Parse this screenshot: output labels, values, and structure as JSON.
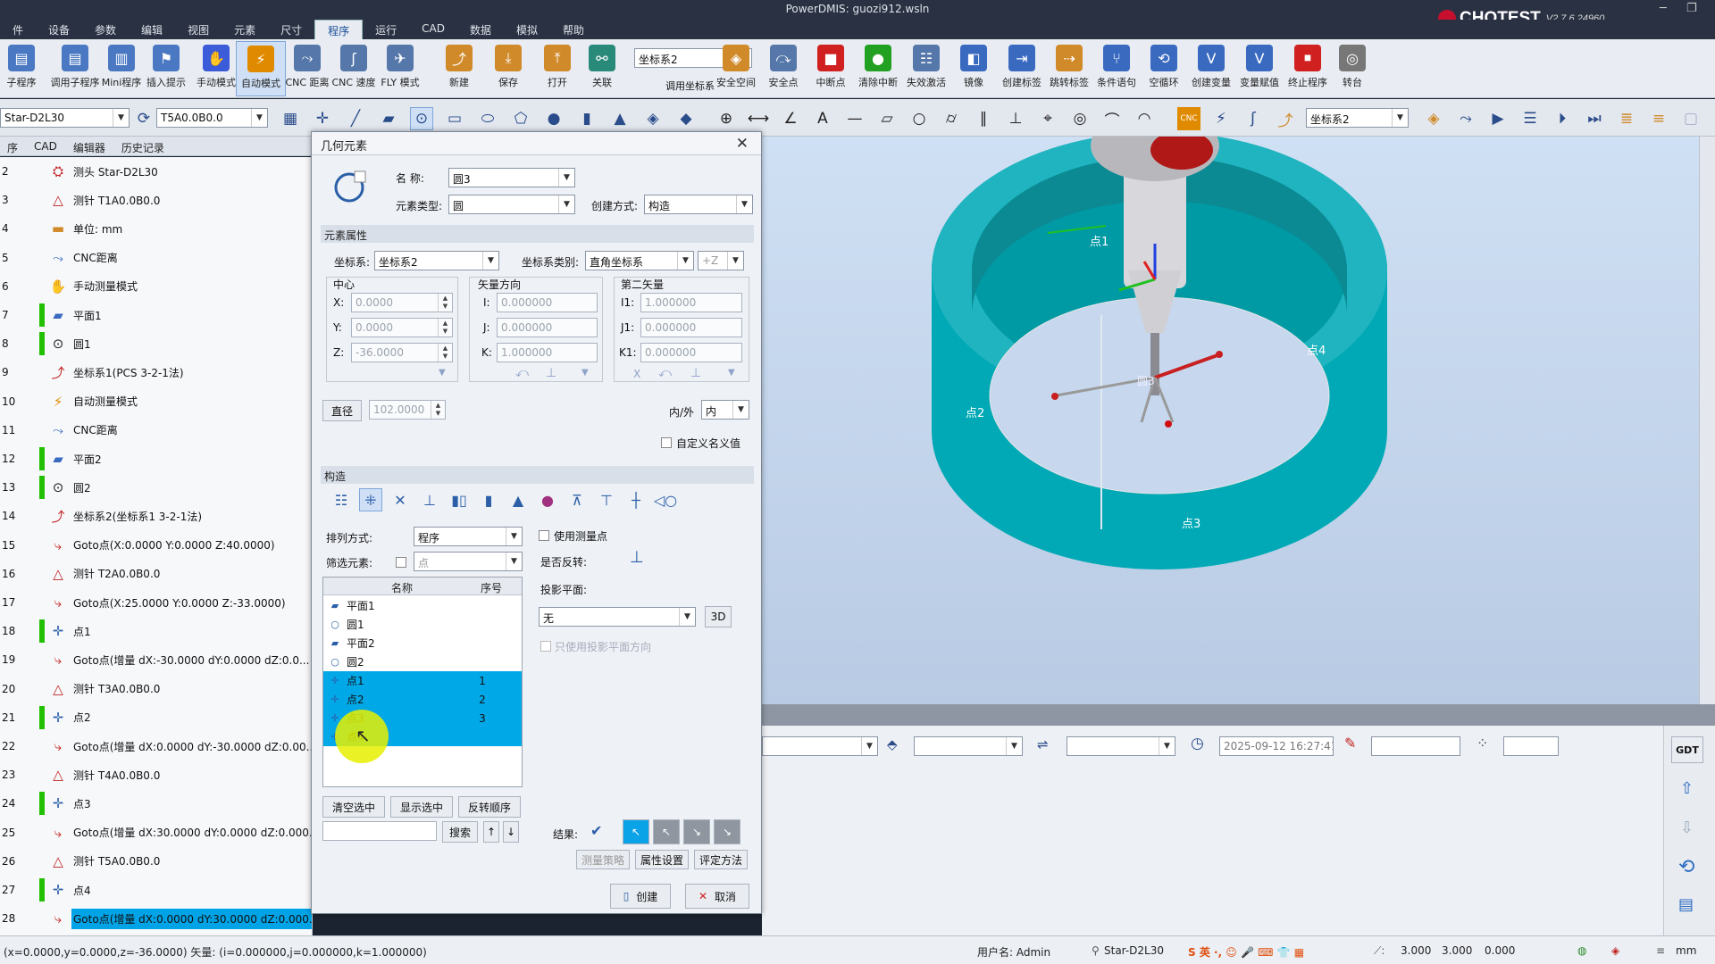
{
  "app": {
    "title": "PowerDMIS: guozi912.wsln",
    "brand": "CHOTEST",
    "version": "V2.7.6.24960"
  },
  "menu": [
    "件",
    "设备",
    "参数",
    "编辑",
    "视图",
    "元素",
    "尺寸",
    "程序",
    "运行",
    "CAD",
    "数据",
    "模拟",
    "帮助"
  ],
  "ribbon": {
    "items": [
      {
        "label": "子程序",
        "icon": "subprogram-icon",
        "color": "#4a78c2"
      },
      {
        "label": "调用子程序",
        "icon": "call-subprogram-icon",
        "color": "#4a78c2"
      },
      {
        "label": "Mini程序",
        "icon": "mini-program-icon",
        "color": "#4a78c2"
      },
      {
        "label": "插入提示",
        "icon": "insert-prompt-icon",
        "color": "#4a78c2"
      },
      {
        "label": "手动模式",
        "icon": "hand-icon",
        "color": "#3c5bd8"
      },
      {
        "label": "自动模式",
        "icon": "cnc-icon",
        "color": "#e08a00"
      },
      {
        "label": "CNC 距离",
        "icon": "cnc-distance-icon",
        "color": "#5577aa"
      },
      {
        "label": "CNC 速度",
        "icon": "cnc-speed-icon",
        "color": "#5577aa"
      },
      {
        "label": "FLY 模式",
        "icon": "fly-mode-icon",
        "color": "#5577aa"
      },
      {
        "label": "新建",
        "icon": "new-coordinate-icon",
        "color": "#d08a2a"
      },
      {
        "label": "保存",
        "icon": "save-coordinate-icon",
        "color": "#d08a2a"
      },
      {
        "label": "打开",
        "icon": "open-coordinate-icon",
        "color": "#d08a2a"
      },
      {
        "label": "关联",
        "icon": "link-icon",
        "color": "#2a8a7a"
      },
      {
        "label": "安全空间",
        "icon": "safe-space-icon",
        "color": "#d08a2a"
      },
      {
        "label": "安全点",
        "icon": "safe-point-icon",
        "color": "#5577aa"
      },
      {
        "label": "中断点",
        "icon": "stop-icon",
        "color": "#d02020"
      },
      {
        "label": "清除中断",
        "icon": "clear-break-icon",
        "color": "#22a022"
      },
      {
        "label": "失效激活",
        "icon": "disable-activate-icon",
        "color": "#5577aa"
      },
      {
        "label": "镜像",
        "icon": "mirror-icon",
        "color": "#3a6ac0"
      },
      {
        "label": "创建标签",
        "icon": "create-label-icon",
        "color": "#3a6ac0"
      },
      {
        "label": "跳转标签",
        "icon": "jump-label-icon",
        "color": "#d08a2a"
      },
      {
        "label": "条件语句",
        "icon": "condition-icon",
        "color": "#3a6ac0"
      },
      {
        "label": "空循环",
        "icon": "loop-icon",
        "color": "#3a6ac0"
      },
      {
        "label": "创建变量",
        "icon": "create-variable-icon",
        "color": "#3a6ac0"
      },
      {
        "label": "变量赋值",
        "icon": "assign-variable-icon",
        "color": "#3a6ac0"
      },
      {
        "label": "终止程序",
        "icon": "end-program-icon",
        "color": "#d02020"
      },
      {
        "label": "转台",
        "icon": "turntable-icon",
        "color": "#777777"
      }
    ],
    "coord_combo": "坐标系2",
    "coord_combo_label": "调用坐标系"
  },
  "toolbar2": {
    "probe": "Star-D2L30",
    "tip": "T5A0.0B0.0",
    "coord": "坐标系2"
  },
  "left_tabs": [
    "序",
    "CAD",
    "编辑器",
    "历史记录"
  ],
  "tree": [
    {
      "num": "2",
      "label": "测头 Star-D2L30",
      "icon": "probe-icon",
      "bar": false,
      "sel": false
    },
    {
      "num": "3",
      "label": "测针 T1A0.0B0.0",
      "icon": "stylus-icon",
      "bar": false,
      "sel": false
    },
    {
      "num": "4",
      "label": "单位: mm",
      "icon": "unit-icon",
      "bar": false,
      "sel": false
    },
    {
      "num": "5",
      "label": "CNC距离",
      "icon": "cnc-distance-icon",
      "bar": false,
      "sel": false
    },
    {
      "num": "6",
      "label": "手动测量模式",
      "icon": "hand-icon",
      "bar": false,
      "sel": false
    },
    {
      "num": "7",
      "label": "平面1",
      "icon": "plane-icon",
      "bar": true,
      "sel": false
    },
    {
      "num": "8",
      "label": "圆1",
      "icon": "circle-icon",
      "bar": true,
      "sel": false
    },
    {
      "num": "9",
      "label": "坐标系1(PCS 3-2-1法)",
      "icon": "coordinate-icon",
      "bar": false,
      "sel": false
    },
    {
      "num": "10",
      "label": "自动测量模式",
      "icon": "cnc-icon",
      "bar": false,
      "sel": false
    },
    {
      "num": "11",
      "label": "CNC距离",
      "icon": "cnc-distance-icon",
      "bar": false,
      "sel": false
    },
    {
      "num": "12",
      "label": "平面2",
      "icon": "plane-icon",
      "bar": true,
      "sel": false
    },
    {
      "num": "13",
      "label": "圆2",
      "icon": "circle-icon",
      "bar": true,
      "sel": false
    },
    {
      "num": "14",
      "label": "坐标系2(坐标系1 3-2-1法)",
      "icon": "coordinate-icon",
      "bar": false,
      "sel": false
    },
    {
      "num": "15",
      "label": "Goto点(X:0.0000 Y:0.0000 Z:40.0000)",
      "icon": "goto-icon",
      "bar": false,
      "sel": false
    },
    {
      "num": "16",
      "label": "测针 T2A0.0B0.0",
      "icon": "stylus-icon",
      "bar": false,
      "sel": false
    },
    {
      "num": "17",
      "label": "Goto点(X:25.0000 Y:0.0000 Z:-33.0000)",
      "icon": "goto-icon",
      "bar": false,
      "sel": false
    },
    {
      "num": "18",
      "label": "点1",
      "icon": "point-icon",
      "bar": true,
      "sel": false
    },
    {
      "num": "19",
      "label": "Goto点(增量 dX:-30.0000  dY:0.0000  dZ:0.0...",
      "icon": "goto-icon",
      "bar": false,
      "sel": false
    },
    {
      "num": "20",
      "label": "测针 T3A0.0B0.0",
      "icon": "stylus-icon",
      "bar": false,
      "sel": false
    },
    {
      "num": "21",
      "label": "点2",
      "icon": "point-icon",
      "bar": true,
      "sel": false
    },
    {
      "num": "22",
      "label": "Goto点(增量 dX:0.0000  dY:-30.0000  dZ:0.00...",
      "icon": "goto-icon",
      "bar": false,
      "sel": false
    },
    {
      "num": "23",
      "label": "测针 T4A0.0B0.0",
      "icon": "stylus-icon",
      "bar": false,
      "sel": false
    },
    {
      "num": "24",
      "label": "点3",
      "icon": "point-icon",
      "bar": true,
      "sel": false
    },
    {
      "num": "25",
      "label": "Goto点(增量 dX:30.0000  dY:0.0000  dZ:0.000...",
      "icon": "goto-icon",
      "bar": false,
      "sel": false
    },
    {
      "num": "26",
      "label": "测针 T5A0.0B0.0",
      "icon": "stylus-icon",
      "bar": false,
      "sel": false
    },
    {
      "num": "27",
      "label": "点4",
      "icon": "point-icon",
      "bar": true,
      "sel": false
    },
    {
      "num": "28",
      "label": "Goto点(增量 dX:0.0000  dY:30.0000  dZ:0.000...",
      "icon": "goto-icon",
      "bar": false,
      "sel": true
    }
  ],
  "dialog": {
    "title": "几何元素",
    "name_label": "名  称:",
    "name_value": "圆3",
    "type_label": "元素类型:",
    "type_value": "圆",
    "create_label": "创建方式:",
    "create_value": "构造",
    "props_section": "元素属性",
    "coord_label": "坐标系:",
    "coord_value": "坐标系2",
    "coordtype_label": "坐标系类别:",
    "coordtype_value": "直角坐标系",
    "axis_value": "+Z",
    "center_label": "中心",
    "x_label": "X:",
    "x_value": "0.0000",
    "y_label": "Y:",
    "y_value": "0.0000",
    "z_label": "Z:",
    "z_value": "-36.0000",
    "vector_label": "矢量方向",
    "i_label": "I:",
    "i_value": "0.000000",
    "j_label": "J:",
    "j_value": "0.000000",
    "k_label": "K:",
    "k_value": "1.000000",
    "second_label": "第二矢量",
    "i1_label": "I1:",
    "i1_value": "1.000000",
    "j1_label": "J1:",
    "j1_value": "0.000000",
    "k1_label": "K1:",
    "k1_value": "0.000000",
    "x_mark": "X",
    "diameter_label": "直径",
    "diameter_value": "102.0000",
    "inout_label": "内/外",
    "inout_value": "内",
    "custom_nominal": "自定义名义值",
    "construct_section": "构造",
    "sort_label": "排列方式:",
    "sort_value": "程序",
    "use_measured": "使用测量点",
    "filter_label": "筛选元素:",
    "filter_value": "点",
    "reverse_label": "是否反转:",
    "projection_label": "投影平面:",
    "projection_value": "无",
    "btn_3d": "3D",
    "projection_only": "只使用投影平面方向",
    "list_headers": [
      "名称",
      "序号"
    ],
    "list_items": [
      {
        "name": "平面1",
        "order": "",
        "icon": "plane-icon",
        "sel": false
      },
      {
        "name": "圆1",
        "order": "",
        "icon": "circle-icon",
        "sel": false
      },
      {
        "name": "平面2",
        "order": "",
        "icon": "plane-icon",
        "sel": false
      },
      {
        "name": "圆2",
        "order": "",
        "icon": "circle-icon",
        "sel": false
      },
      {
        "name": "点1",
        "order": "1",
        "icon": "point-icon",
        "sel": true
      },
      {
        "name": "点2",
        "order": "2",
        "icon": "point-icon",
        "sel": true
      },
      {
        "name": "点3",
        "order": "3",
        "icon": "point-icon",
        "sel": true
      },
      {
        "name": "点4",
        "order": "",
        "icon": "point-icon",
        "sel": true
      }
    ],
    "btn_clear": "清空选中",
    "btn_show": "显示选中",
    "btn_reverse": "反转顺序",
    "btn_search": "搜索",
    "result_label": "结果:",
    "tab_strategy": "测量策略",
    "tab_props": "属性设置",
    "tab_eval": "评定方法",
    "btn_create": "创建",
    "btn_cancel": "取消"
  },
  "viewport": {
    "labels": [
      "点1",
      "点4",
      "点2",
      "点3",
      "圆3"
    ]
  },
  "bottom": {
    "datetime": "2025-09-12 16:27:41"
  },
  "gdt": "GDT",
  "status": {
    "coords": "(x=0.0000,y=0.0000,z=-36.0000)  矢量: (i=0.000000,j=0.000000,k=1.000000)",
    "user": "用户名: Admin",
    "probe": "Star-D2L30",
    "v1": "3.000",
    "v2": "3.000",
    "v3": "0.000",
    "unit": "mm"
  }
}
